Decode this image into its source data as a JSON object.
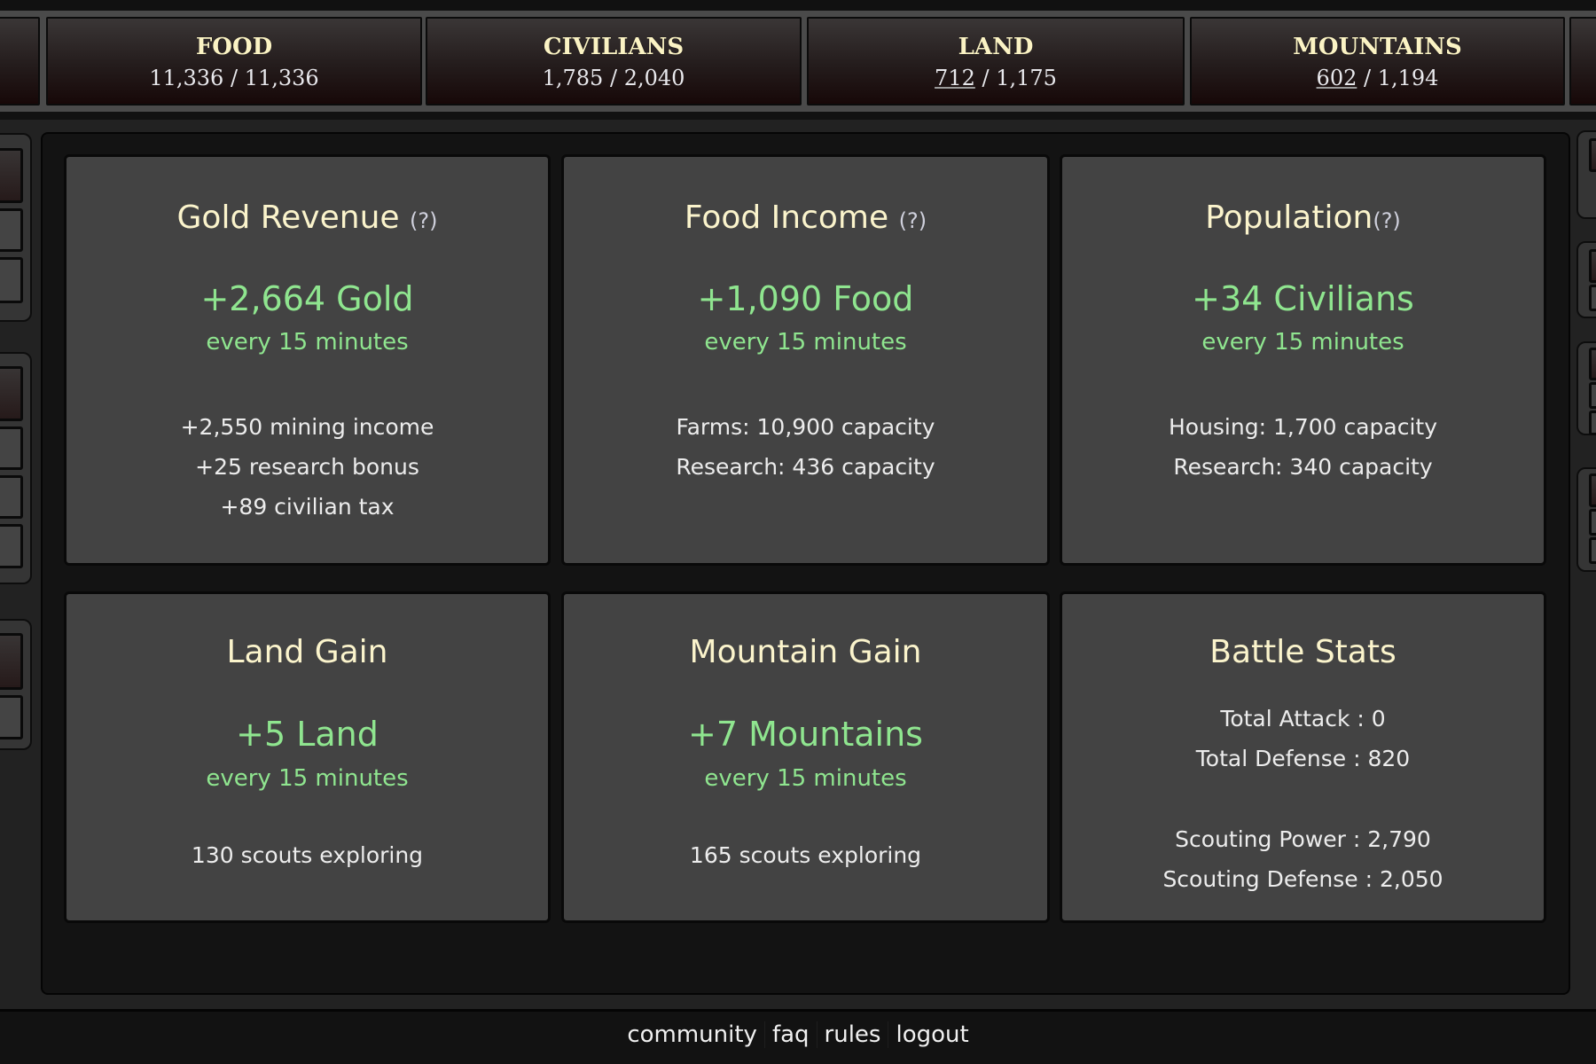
{
  "resources": [
    {
      "label": "FOOD",
      "current": "11,336",
      "max": "11,336",
      "current_linked": false
    },
    {
      "label": "CIVILIANS",
      "current": "1,785",
      "max": "2,040",
      "current_linked": false
    },
    {
      "label": "LAND",
      "current": "712",
      "max": "1,175",
      "current_linked": true
    },
    {
      "label": "MOUNTAINS",
      "current": "602",
      "max": "1,194",
      "current_linked": true
    }
  ],
  "separator": "/",
  "cards": {
    "gold": {
      "title": "Gold Revenue",
      "help": "(?)",
      "amount": "+2,664 Gold",
      "period": "every 15 minutes",
      "lines": [
        "+2,550 mining income",
        "+25 research bonus",
        "+89 civilian tax"
      ]
    },
    "food": {
      "title": "Food Income",
      "help": "(?)",
      "amount": "+1,090 Food",
      "period": "every 15 minutes",
      "lines": [
        "Farms: 10,900 capacity",
        "Research: 436 capacity"
      ]
    },
    "population": {
      "title": "Population",
      "help": "(?)",
      "amount": "+34 Civilians",
      "period": "every 15 minutes",
      "lines": [
        "Housing: 1,700 capacity",
        "Research: 340 capacity"
      ]
    },
    "land": {
      "title": "Land Gain",
      "amount": "+5 Land",
      "period": "every 15 minutes",
      "lines": [
        "130 scouts exploring"
      ]
    },
    "mountain": {
      "title": "Mountain Gain",
      "amount": "+7 Mountains",
      "period": "every 15 minutes",
      "lines": [
        "165 scouts exploring"
      ]
    },
    "battle": {
      "title": "Battle Stats",
      "combat_lines": [
        "Total Attack : 0",
        "Total Defense : 820"
      ],
      "scouting_lines": [
        "Scouting Power : 2,790",
        "Scouting Defense : 2,050"
      ]
    }
  },
  "footer": {
    "links": [
      "community",
      "faq",
      "rules",
      "logout"
    ]
  },
  "colors": {
    "accent_green": "#8fe58f",
    "title_cream": "#fbf4cc",
    "card_bg": "#434343"
  }
}
